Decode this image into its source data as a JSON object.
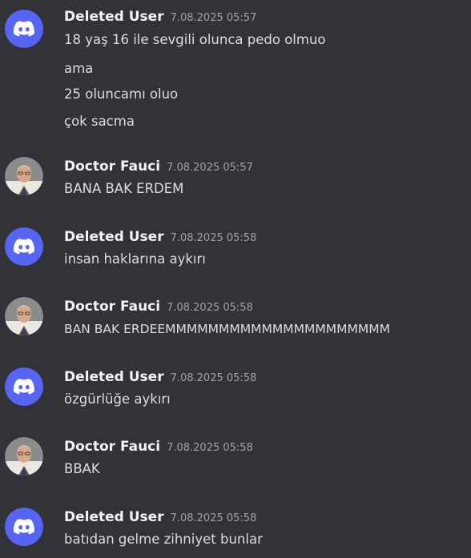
{
  "messages": [
    {
      "author": "Deleted User",
      "avatar": "discord-logo-icon",
      "timestamp": "7.08.2025 05:57",
      "lines": [
        "18 yaş 16 ile sevgili olunca pedo olmuo",
        "ama",
        "25 oluncamı oluo",
        "çok sacma"
      ]
    },
    {
      "author": "Doctor Fauci",
      "avatar": "user-photo-avatar",
      "timestamp": "7.08.2025 05:57",
      "lines": [
        "BANA BAK ERDEM"
      ]
    },
    {
      "author": "Deleted User",
      "avatar": "discord-logo-icon",
      "timestamp": "7.08.2025 05:58",
      "lines": [
        "insan haklarına aykırı"
      ]
    },
    {
      "author": "Doctor Fauci",
      "avatar": "user-photo-avatar",
      "timestamp": "7.08.2025 05:58",
      "lines": [
        "BAN BAK ERDEEMMMMMMMMMMMMMMMMMMMMM"
      ]
    },
    {
      "author": "Deleted User",
      "avatar": "discord-logo-icon",
      "timestamp": "7.08.2025 05:58",
      "lines": [
        "özgürlüğe aykırı"
      ]
    },
    {
      "author": "Doctor Fauci",
      "avatar": "user-photo-avatar",
      "timestamp": "7.08.2025 05:58",
      "lines": [
        "BBAK"
      ]
    },
    {
      "author": "Deleted User",
      "avatar": "discord-logo-icon",
      "timestamp": "7.08.2025 05:58",
      "lines": [
        "batıdan gelme zihniyet bunlar"
      ]
    }
  ],
  "colors": {
    "background": "#323339",
    "discord_blurple": "#5865f2",
    "username": "#f2f3f5",
    "timestamp": "#a1a2a8",
    "message_text": "#dcdde1"
  }
}
